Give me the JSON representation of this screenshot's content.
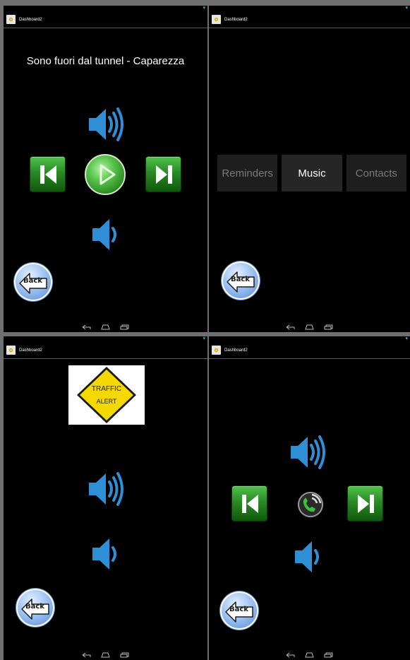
{
  "app": {
    "title": "Dashboard2"
  },
  "music_screen": {
    "song_title": "Sono fuori dal tunnel - Caparezza",
    "back_label": "Back",
    "icons": {
      "volume_up": "speaker-volume-up-icon",
      "volume_down": "speaker-volume-down-icon",
      "previous": "skip-previous-icon",
      "play": "play-icon",
      "next": "skip-next-icon"
    }
  },
  "menu_screen": {
    "tabs": [
      {
        "label": "Reminders",
        "active": false
      },
      {
        "label": "Music",
        "active": true
      },
      {
        "label": "Contacts",
        "active": false
      }
    ],
    "back_label": "Back"
  },
  "alert_screen": {
    "sign_line1": "TRAFFIC",
    "sign_line2": "ALERT",
    "back_label": "Back"
  },
  "call_screen": {
    "back_label": "Back",
    "icons": {
      "call": "phone-call-icon"
    }
  },
  "colors": {
    "accent": "#33b5e5",
    "speaker_blue": "#2e8fd6",
    "button_green": "#2a8a25",
    "sign_yellow": "#f5d800"
  }
}
